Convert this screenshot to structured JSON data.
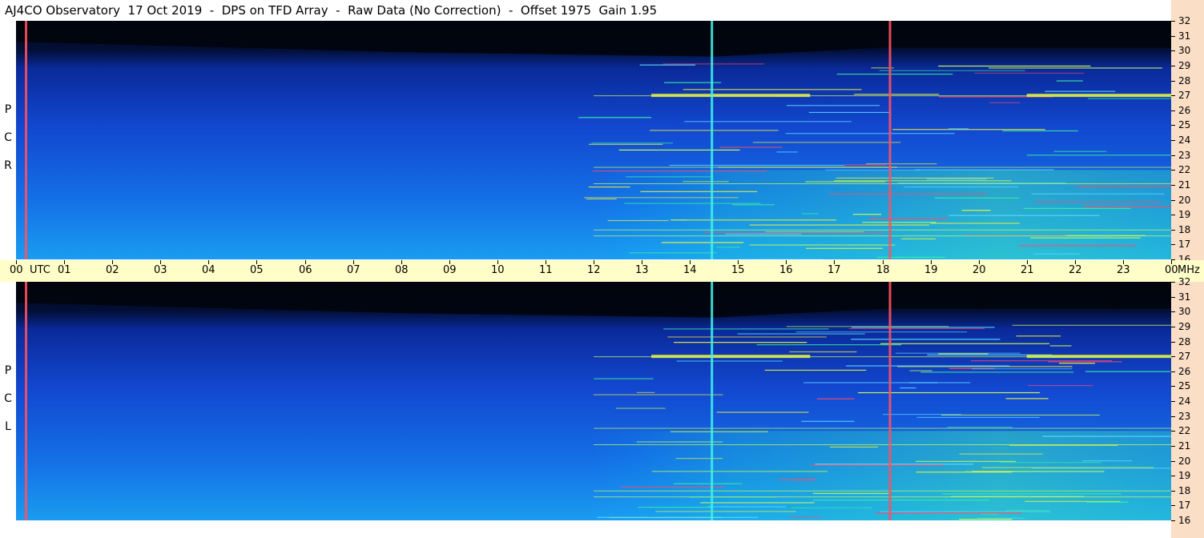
{
  "title": "AJ4CO Observatory  17 Oct 2019  -  DPS on TFD Array  -  Raw Data (No Correction)  -  Offset 1975  Gain 1.95",
  "panels": [
    {
      "id": "rcp",
      "label": "RCP"
    },
    {
      "id": "lcp",
      "label": "LCP"
    }
  ],
  "time_axis": {
    "labels": [
      "00",
      "01",
      "02",
      "03",
      "04",
      "05",
      "06",
      "07",
      "08",
      "09",
      "10",
      "11",
      "12",
      "13",
      "14",
      "15",
      "16",
      "17",
      "18",
      "19",
      "20",
      "21",
      "22",
      "23",
      "00"
    ],
    "utc_label": "UTC",
    "mhz_label": "MHz"
  },
  "freq_axis": {
    "labels": [
      "32",
      "31",
      "30",
      "29",
      "28",
      "27",
      "26",
      "25",
      "24",
      "23",
      "22",
      "21",
      "20",
      "19",
      "18",
      "17",
      "16"
    ]
  },
  "colors": {
    "background": "#ffffff",
    "time_bar": "#fffec8",
    "freq_strip": "#fbdec6",
    "plot_base": "#1a53d6"
  },
  "chart_data": {
    "type": "heatmap",
    "title": "AJ4CO Observatory  17 Oct 2019  -  DPS on TFD Array  -  Raw Data (No Correction)  -  Offset 1975  Gain 1.95",
    "x": {
      "label": "UTC",
      "range": [
        0,
        24
      ],
      "ticks": [
        "00",
        "01",
        "02",
        "03",
        "04",
        "05",
        "06",
        "07",
        "08",
        "09",
        "10",
        "11",
        "12",
        "13",
        "14",
        "15",
        "16",
        "17",
        "18",
        "19",
        "20",
        "21",
        "22",
        "23",
        "00"
      ]
    },
    "y": {
      "label": "MHz",
      "range": [
        16,
        32
      ],
      "ticks": [
        32,
        31,
        30,
        29,
        28,
        27,
        26,
        25,
        24,
        23,
        22,
        21,
        20,
        19,
        18,
        17,
        16
      ]
    },
    "panels": [
      "RCP",
      "LCP"
    ],
    "colormap": "black-blue-cyan-green-yellow-red",
    "features": [
      {
        "kind": "vertical_interference",
        "utc": 0.2,
        "color": "red"
      },
      {
        "kind": "vertical_interference",
        "utc": 14.45,
        "color": "cyan"
      },
      {
        "kind": "vertical_interference",
        "utc": 18.15,
        "color": "red"
      },
      {
        "kind": "persistent_carrier",
        "mhz": 27.0,
        "utc_range": [
          13.2,
          16.5
        ]
      },
      {
        "kind": "persistent_carrier",
        "mhz": 27.0,
        "utc_range": [
          21.0,
          24.0
        ]
      },
      {
        "kind": "daytime_noise_rise",
        "utc_range": [
          12.0,
          24.0
        ],
        "mhz_range": [
          16,
          22
        ]
      }
    ]
  }
}
